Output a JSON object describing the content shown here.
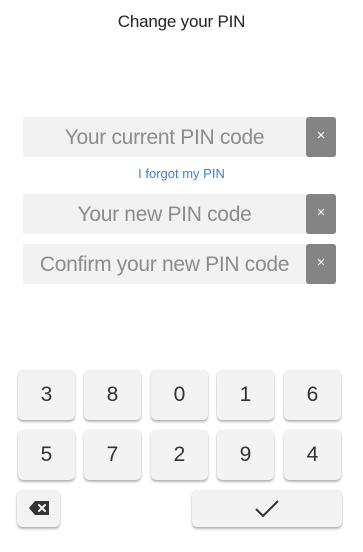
{
  "header": {
    "title": "Change your PIN"
  },
  "fields": [
    {
      "placeholder": "Your current PIN code",
      "clear_label": "×"
    },
    {
      "placeholder": "Your new PIN code",
      "clear_label": "×"
    },
    {
      "placeholder": "Confirm your new PIN code",
      "clear_label": "×"
    }
  ],
  "forgot_link": "I forgot my PIN",
  "keypad": {
    "row1": [
      "3",
      "8",
      "0",
      "1",
      "6"
    ],
    "row2": [
      "5",
      "7",
      "2",
      "9",
      "4"
    ],
    "backspace_icon": "backspace-icon",
    "confirm_icon": "checkmark-icon"
  }
}
